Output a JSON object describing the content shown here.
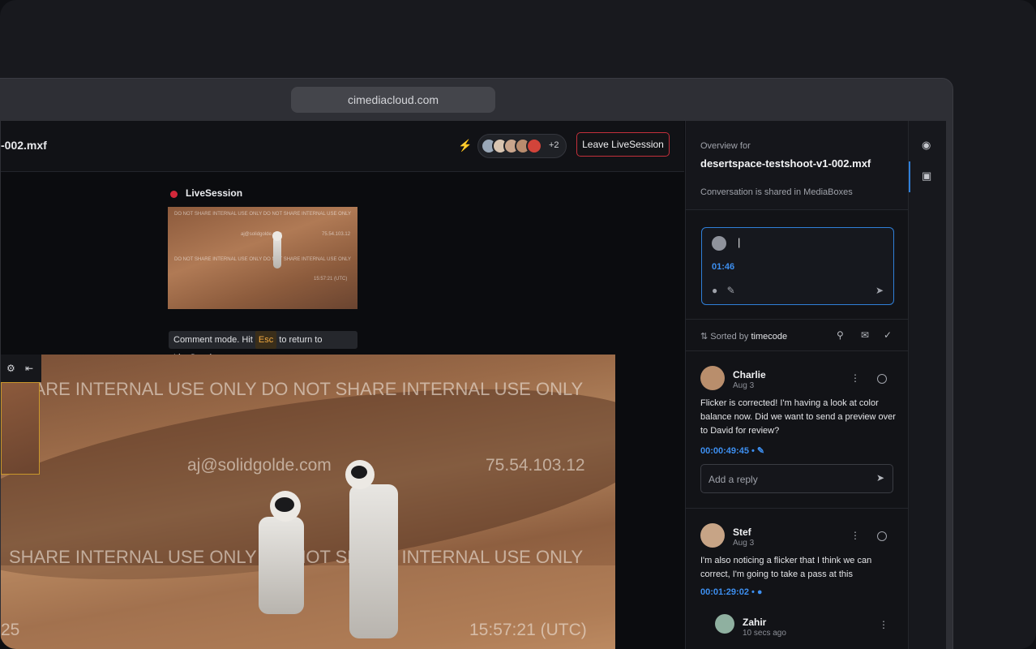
{
  "browser": {
    "url": "cimediacloud.com"
  },
  "topbar": {
    "filename": "-002.mxf",
    "participants_more": "+2",
    "leave_label": "Leave LiveSession"
  },
  "live": {
    "label": "LiveSession",
    "thumb_watermark_1": "DO NOT SHARE INTERNAL USE ONLY DO NOT SHARE INTERNAL USE ONLY",
    "thumb_watermark_2": "aj@solidgolde.com",
    "thumb_watermark_3": "75.54.103.12",
    "thumb_watermark_4": "DO NOT SHARE INTERNAL USE ONLY DO NOT SHARE INTERNAL USE ONLY",
    "thumb_watermark_5": "15:57:21 (UTC)",
    "tooltip_before": "Comment mode. Hit",
    "tooltip_key": "Esc",
    "tooltip_after": "to return to LiveSession."
  },
  "player": {
    "watermark_top": "SHARE INTERNAL USE ONLY DO NOT SHARE INTERNAL USE ONLY",
    "email": "aj@solidgolde.com",
    "ip": "75.54.103.12",
    "watermark_mid": "SHARE INTERNAL USE ONLY DO NOT SHARE INTERNAL USE ONLY",
    "left_num": "25",
    "timestamp": "15:57:21 (UTC)"
  },
  "overview": {
    "label": "Overview for",
    "file": "desertspace-testshoot-v1-002.mxf",
    "shared": "Conversation is shared in MediaBoxes"
  },
  "composer": {
    "caret": "|",
    "timecode": "01:46"
  },
  "sort": {
    "prefix": "Sorted by",
    "key": "timecode"
  },
  "comments": [
    {
      "name": "Charlie",
      "date": "Aug 3",
      "body": "Flicker is corrected! I'm having a look at color balance now. Did we want to send a preview over to David for review?",
      "timecode": "00:00:49:45 •",
      "reply_placeholder": "Add a reply"
    },
    {
      "name": "Stef",
      "date": "Aug 3",
      "body": "I'm also noticing a flicker that I think we can correct, I'm going to take a pass at this",
      "timecode": "00:01:29:02 •"
    }
  ],
  "reply": {
    "name": "Zahir",
    "date": "10 secs ago"
  },
  "colors": {
    "accent": "#2f7fd8",
    "live": "#d3283a",
    "leave_border": "#c3303b",
    "bolt": "#7ec13b"
  },
  "icons": [
    "bolt-icon",
    "settings-icon",
    "collapse-icon",
    "pin-icon",
    "brush-icon",
    "send-icon",
    "sort-icon",
    "search-icon",
    "bell-icon",
    "check-circle-icon",
    "more-icon",
    "eye-icon",
    "chat-icon"
  ]
}
